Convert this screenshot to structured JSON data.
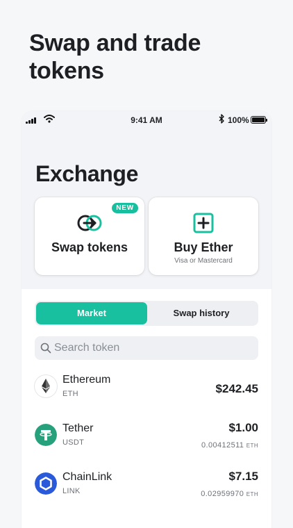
{
  "headline": "Swap and trade tokens",
  "status_bar": {
    "time": "9:41 AM",
    "battery_percent": "100%"
  },
  "title": "Exchange",
  "cards": {
    "swap": {
      "label": "Swap tokens",
      "badge": "NEW",
      "icon": "swap-arrow-icon"
    },
    "buy": {
      "label": "Buy Ether",
      "subtitle": "Visa or Mastercard",
      "icon": "plus-square-icon"
    }
  },
  "tabs": {
    "market": "Market",
    "swap_history": "Swap history",
    "active": "Market"
  },
  "search": {
    "placeholder": "Search token",
    "value": ""
  },
  "tokens": [
    {
      "name": "Ethereum",
      "symbol": "ETH",
      "price": "$242.45",
      "eth_value": "",
      "eth_unit": "",
      "icon": "ethereum-icon"
    },
    {
      "name": "Tether",
      "symbol": "USDT",
      "price": "$1.00",
      "eth_value": "0.00412511",
      "eth_unit": "ETH",
      "icon": "tether-icon"
    },
    {
      "name": "ChainLink",
      "symbol": "LINK",
      "price": "$7.15",
      "eth_value": "0.02959970",
      "eth_unit": "ETH",
      "icon": "chainlink-icon"
    }
  ],
  "colors": {
    "accent": "#19c09f",
    "tether": "#26a17b",
    "chainlink": "#2a5ada",
    "text": "#1d1f22"
  }
}
